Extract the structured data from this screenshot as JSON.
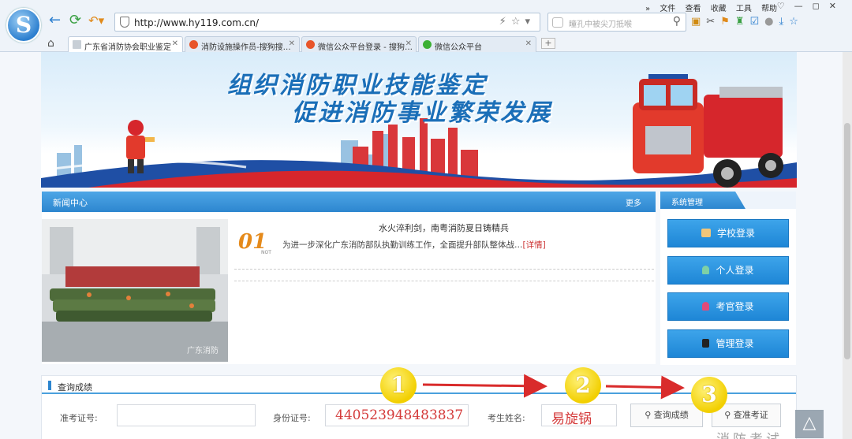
{
  "browser": {
    "menu": [
      "文件",
      "查看",
      "收藏",
      "工具",
      "帮助"
    ],
    "url": "http://www.hy119.com.cn/",
    "search_placeholder": "瞳孔中被尖刀抵喉",
    "tabs": [
      {
        "label": "广东省消防协会职业鉴定",
        "active": true,
        "icon_color": "#9aa"
      },
      {
        "label": "消防设施操作员-搜狗搜…",
        "active": false,
        "icon_color": "#e8552a"
      },
      {
        "label": "微信公众平台登录 - 搜狗…",
        "active": false,
        "icon_color": "#e8552a"
      },
      {
        "label": "微信公众平台",
        "active": false,
        "icon_color": "#3cb034"
      }
    ]
  },
  "banner": {
    "line1": "组织消防职业技能鉴定",
    "line2": "促进消防事业繁荣发展"
  },
  "news": {
    "header": "新闻中心",
    "more": "更多",
    "title": "水火淬利剑，南粤消防夏日铸精兵",
    "number": "01",
    "number_sub": "NOT",
    "desc": "为进一步深化广东消防部队执勤训练工作，全面提升部队整体战…",
    "detail_link": "[详情]",
    "photo_caption": "广东消防"
  },
  "system": {
    "header": "系统管理",
    "buttons": [
      {
        "label": "学校登录",
        "icon": "bank-icon",
        "icon_color": "#f1c67a"
      },
      {
        "label": "个人登录",
        "icon": "person-icon",
        "icon_color": "#7ed0a6"
      },
      {
        "label": "考官登录",
        "icon": "examiner-icon",
        "icon_color": "#e24b7a"
      },
      {
        "label": "管理登录",
        "icon": "lock-icon",
        "icon_color": "#222"
      }
    ]
  },
  "query": {
    "header": "查询成绩",
    "ticket_label": "准考证号:",
    "ticket_value": "",
    "id_label": "身份证号:",
    "id_value": "440523948483837",
    "name_label": "考生姓名:",
    "name_value": "易旋锅",
    "btn_score": "查询成绩",
    "btn_ticket": "查准考证"
  },
  "annotations": [
    "1",
    "2",
    "3"
  ],
  "watermark": "消防考试"
}
